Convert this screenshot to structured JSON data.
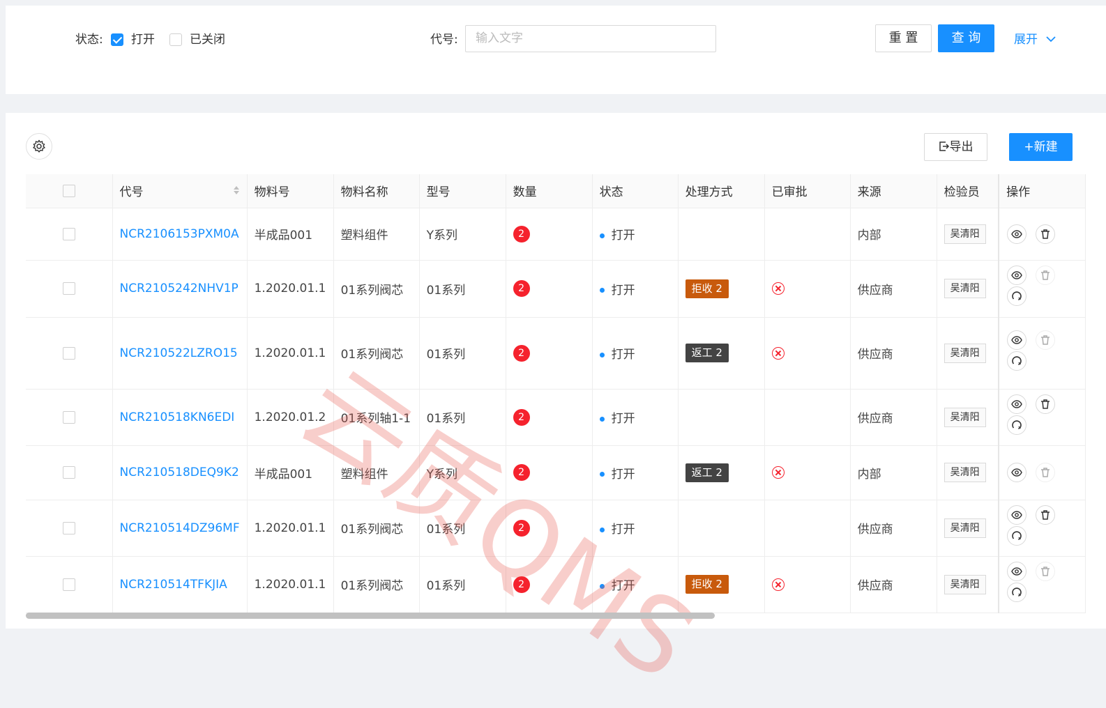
{
  "filter": {
    "status_label": "状态:",
    "opt_open": "打开",
    "opt_open_checked": true,
    "opt_closed": "已关闭",
    "opt_closed_checked": false,
    "code_label": "代号:",
    "code_placeholder": "输入文字",
    "reset_label": "重 置",
    "query_label": "查 询",
    "expand_label": "展开"
  },
  "toolbar": {
    "export_label": "导出",
    "new_label": "+新建"
  },
  "table": {
    "columns": [
      "代号",
      "物料号",
      "物料名称",
      "型号",
      "数量",
      "状态",
      "处理方式",
      "已审批",
      "来源",
      "检验员",
      "操作"
    ],
    "rows": [
      {
        "code": "NCR2106153PXM0A",
        "material_no": "半成品001",
        "material_name": "塑料组件",
        "model": "Y系列",
        "qty": "2",
        "status": "打开",
        "handling": "",
        "handling_type": "",
        "approved": false,
        "source": "内部",
        "inspector": "吴清阳",
        "delete_enabled": true,
        "has_revoke": false
      },
      {
        "code": "NCR2105242NHV1P",
        "material_no": "1.2020.01.1",
        "material_name": "01系列阀芯",
        "model": "01系列",
        "qty": "2",
        "status": "打开",
        "handling": "拒收 2",
        "handling_type": "reject",
        "approved": true,
        "source": "供应商",
        "inspector": "吴清阳",
        "delete_enabled": false,
        "has_revoke": true
      },
      {
        "code": "NCR210522LZRO15",
        "material_no": "1.2020.01.1",
        "material_name": "01系列阀芯",
        "model": "01系列",
        "qty": "2",
        "status": "打开",
        "handling": "返工 2",
        "handling_type": "rework",
        "approved": true,
        "source": "供应商",
        "inspector": "吴清阳",
        "delete_enabled": false,
        "has_revoke": true
      },
      {
        "code": "NCR210518KN6EDI",
        "material_no": "1.2020.01.2",
        "material_name": "01系列轴1-1",
        "model": "01系列",
        "qty": "2",
        "status": "打开",
        "handling": "",
        "handling_type": "",
        "approved": false,
        "source": "供应商",
        "inspector": "吴清阳",
        "delete_enabled": true,
        "has_revoke": true
      },
      {
        "code": "NCR210518DEQ9K2",
        "material_no": "半成品001",
        "material_name": "塑料组件",
        "model": "Y系列",
        "qty": "2",
        "status": "打开",
        "handling": "返工 2",
        "handling_type": "rework",
        "approved": true,
        "source": "内部",
        "inspector": "吴清阳",
        "delete_enabled": false,
        "has_revoke": false
      },
      {
        "code": "NCR210514DZ96MF",
        "material_no": "1.2020.01.1",
        "material_name": "01系列阀芯",
        "model": "01系列",
        "qty": "2",
        "status": "打开",
        "handling": "",
        "handling_type": "",
        "approved": false,
        "source": "供应商",
        "inspector": "吴清阳",
        "delete_enabled": true,
        "has_revoke": true
      },
      {
        "code": "NCR210514TFKJIA",
        "material_no": "1.2020.01.1",
        "material_name": "01系列阀芯",
        "model": "01系列",
        "qty": "2",
        "status": "打开",
        "handling": "拒收 2",
        "handling_type": "reject",
        "approved": true,
        "source": "供应商",
        "inspector": "吴清阳",
        "delete_enabled": false,
        "has_revoke": true
      }
    ]
  },
  "watermark": "云质QMS",
  "colors": {
    "primary": "#1890ff",
    "danger": "#f5222d",
    "reject": "#c85a0c",
    "rework": "#434343"
  }
}
